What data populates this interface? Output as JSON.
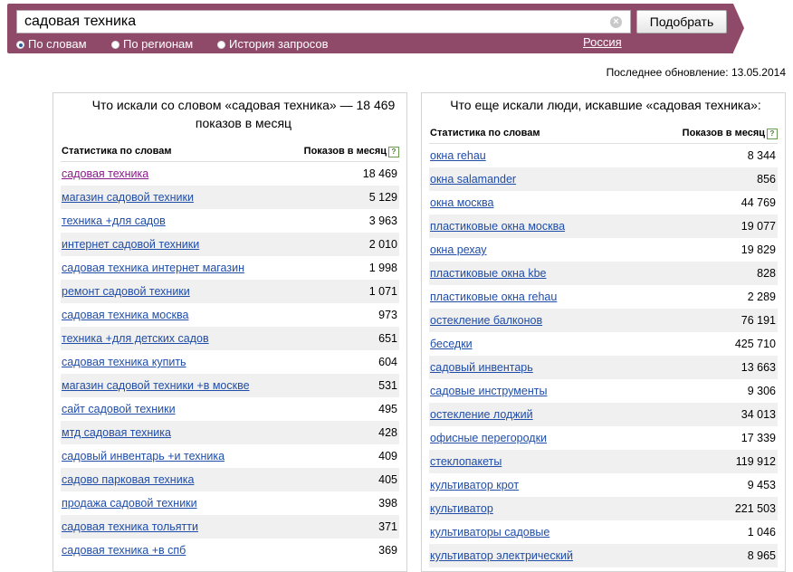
{
  "search": {
    "query": "садовая техника",
    "submit_label": "Подобрать",
    "modes": [
      {
        "label": "По словам",
        "selected": true
      },
      {
        "label": "По регионам",
        "selected": false
      },
      {
        "label": "История запросов",
        "selected": false
      }
    ],
    "region": "Россия"
  },
  "last_update": "Последнее обновление: 13.05.2014",
  "left_panel": {
    "title": "Что искали со словом «садовая техника» — 18 469 показов в месяц",
    "col_phrase": "Статистика по словам",
    "col_count": "Показов в месяц",
    "help": "?",
    "rows": [
      {
        "phrase": "садовая техника",
        "count": "18 469"
      },
      {
        "phrase": "магазин садовой техники",
        "count": "5 129"
      },
      {
        "phrase": "техника +для садов",
        "count": "3 963"
      },
      {
        "phrase": "интернет садовой техники",
        "count": "2 010"
      },
      {
        "phrase": "садовая техника интернет магазин",
        "count": "1 998"
      },
      {
        "phrase": "ремонт садовой техники",
        "count": "1 071"
      },
      {
        "phrase": "садовая техника москва",
        "count": "973"
      },
      {
        "phrase": "техника +для детских садов",
        "count": "651"
      },
      {
        "phrase": "садовая техника купить",
        "count": "604"
      },
      {
        "phrase": "магазин садовой техники +в москве",
        "count": "531"
      },
      {
        "phrase": "сайт садовой техники",
        "count": "495"
      },
      {
        "phrase": "мтд садовая техника",
        "count": "428"
      },
      {
        "phrase": "садовый инвентарь +и техника",
        "count": "409"
      },
      {
        "phrase": "садово парковая техника",
        "count": "405"
      },
      {
        "phrase": "продажа садовой техники",
        "count": "398"
      },
      {
        "phrase": "садовая техника тольятти",
        "count": "371"
      },
      {
        "phrase": "садовая техника +в спб",
        "count": "369"
      }
    ]
  },
  "right_panel": {
    "title": "Что еще искали люди, искавшие «садовая техника»:",
    "col_phrase": "Статистика по словам",
    "col_count": "Показов в месяц",
    "help": "?",
    "rows": [
      {
        "phrase": "окна rehau",
        "count": "8 344"
      },
      {
        "phrase": "окна salamander",
        "count": "856"
      },
      {
        "phrase": "окна москва",
        "count": "44 769"
      },
      {
        "phrase": "пластиковые окна москва",
        "count": "19 077"
      },
      {
        "phrase": "окна рехау",
        "count": "19 829"
      },
      {
        "phrase": "пластиковые окна kbe",
        "count": "828"
      },
      {
        "phrase": "пластиковые окна rehau",
        "count": "2 289"
      },
      {
        "phrase": "остекление балконов",
        "count": "76 191"
      },
      {
        "phrase": "беседки",
        "count": "425 710"
      },
      {
        "phrase": "садовый инвентарь",
        "count": "13 663"
      },
      {
        "phrase": "садовые инструменты",
        "count": "9 306"
      },
      {
        "phrase": "остекление лоджий",
        "count": "34 013"
      },
      {
        "phrase": "офисные перегородки",
        "count": "17 339"
      },
      {
        "phrase": "стеклопакеты",
        "count": "119 912"
      },
      {
        "phrase": "культиватор крот",
        "count": "9 453"
      },
      {
        "phrase": "культиватор",
        "count": "221 503"
      },
      {
        "phrase": "культиваторы садовые",
        "count": "1 046"
      },
      {
        "phrase": "культиватор электрический",
        "count": "8 965"
      }
    ]
  }
}
